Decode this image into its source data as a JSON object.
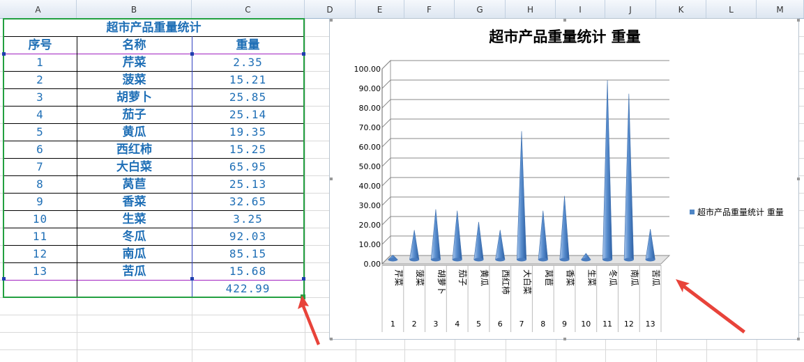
{
  "columns": [
    "A",
    "B",
    "C",
    "D",
    "E",
    "F",
    "G",
    "H",
    "I",
    "J",
    "K",
    "L",
    "M"
  ],
  "table": {
    "title": "超市产品重量统计",
    "headers": [
      "序号",
      "名称",
      "重量"
    ],
    "rows": [
      {
        "no": "1",
        "name": "芹菜",
        "weight": "2.35"
      },
      {
        "no": "2",
        "name": "菠菜",
        "weight": "15.21"
      },
      {
        "no": "3",
        "name": "胡萝卜",
        "weight": "25.85"
      },
      {
        "no": "4",
        "name": "茄子",
        "weight": "25.14"
      },
      {
        "no": "5",
        "name": "黄瓜",
        "weight": "19.35"
      },
      {
        "no": "6",
        "name": "西红柿",
        "weight": "15.25"
      },
      {
        "no": "7",
        "name": "大白菜",
        "weight": "65.95"
      },
      {
        "no": "8",
        "name": "莴苣",
        "weight": "25.13"
      },
      {
        "no": "9",
        "name": "香菜",
        "weight": "32.65"
      },
      {
        "no": "10",
        "name": "生菜",
        "weight": "3.25"
      },
      {
        "no": "11",
        "name": "冬瓜",
        "weight": "92.03"
      },
      {
        "no": "12",
        "name": "南瓜",
        "weight": "85.15"
      },
      {
        "no": "13",
        "name": "苦瓜",
        "weight": "15.68"
      }
    ],
    "total": "422.99"
  },
  "colors": {
    "accent": "#1f6fb6",
    "selection_border": "#22a040",
    "cone": "#5b8fcf",
    "arrow": "#e8433a"
  },
  "chart_data": {
    "type": "bar",
    "title": "超市产品重量统计 重量",
    "categories": [
      "芹菜",
      "菠菜",
      "胡萝卜",
      "茄子",
      "黄瓜",
      "西红柿",
      "大白菜",
      "莴苣",
      "香菜",
      "生菜",
      "冬瓜",
      "南瓜",
      "苦瓜"
    ],
    "category_numbers": [
      "1",
      "2",
      "3",
      "4",
      "5",
      "6",
      "7",
      "8",
      "9",
      "10",
      "11",
      "12",
      "13"
    ],
    "series": [
      {
        "name": "超市产品重量统计 重量",
        "values": [
          2.35,
          15.21,
          25.85,
          25.14,
          19.35,
          15.25,
          65.95,
          25.13,
          32.65,
          3.25,
          92.03,
          85.15,
          15.68
        ]
      }
    ],
    "ylim": [
      0,
      100
    ],
    "yticks": [
      "0.00",
      "10.00",
      "20.00",
      "30.00",
      "40.00",
      "50.00",
      "60.00",
      "70.00",
      "80.00",
      "90.00",
      "100.00"
    ],
    "grid": true,
    "legend_position": "right",
    "shape": "cone"
  }
}
